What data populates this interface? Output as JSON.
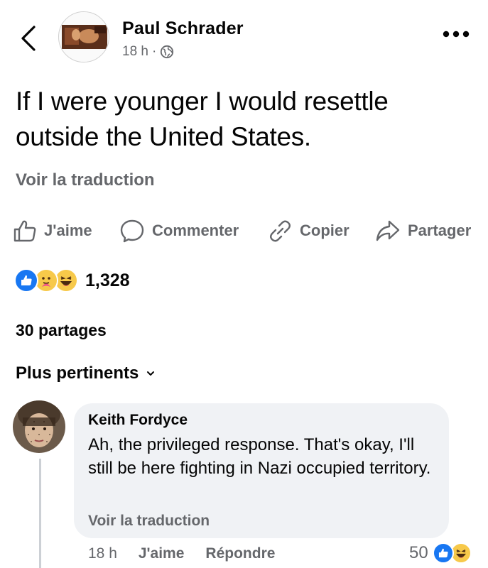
{
  "post": {
    "author": "Paul Schrader",
    "time": "18 h",
    "separator": "·",
    "text": "If I were younger I would resettle outside the United States.",
    "translate_label": "Voir la traduction"
  },
  "actions": {
    "like": "J'aime",
    "comment": "Commenter",
    "copy": "Copier",
    "share": "Partager"
  },
  "reactions": {
    "count": "1,328",
    "types": [
      "like",
      "care",
      "haha"
    ]
  },
  "shares": "30 partages",
  "sort_label": "Plus pertinents",
  "comment": {
    "author": "Keith Fordyce",
    "text": "Ah, the privileged response. That's okay, I'll still be here fighting in Nazi occupied territory.",
    "translate_label": "Voir la traduction",
    "time": "18 h",
    "like_label": "J'aime",
    "reply_label": "Répondre",
    "reaction_count": "50",
    "reaction_types": [
      "like",
      "haha"
    ]
  },
  "colors": {
    "text": "#050505",
    "secondary": "#65676b",
    "bubble": "#f0f2f5",
    "like_blue": "#1877f2",
    "emoji_yellow": "#f7c94a"
  }
}
